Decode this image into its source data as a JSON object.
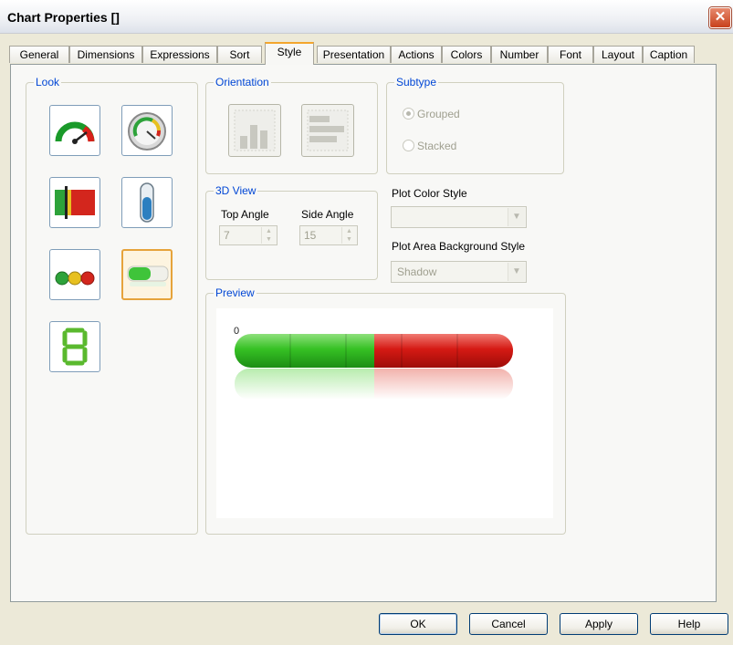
{
  "window": {
    "title": "Chart Properties []",
    "close_icon": "close-icon"
  },
  "tabs": [
    {
      "label": "General"
    },
    {
      "label": "Dimensions"
    },
    {
      "label": "Expressions"
    },
    {
      "label": "Sort"
    },
    {
      "label": "Style",
      "active": true
    },
    {
      "label": "Presentation"
    },
    {
      "label": "Actions"
    },
    {
      "label": "Colors"
    },
    {
      "label": "Number"
    },
    {
      "label": "Font"
    },
    {
      "label": "Layout"
    },
    {
      "label": "Caption"
    }
  ],
  "look": {
    "label": "Look",
    "options": [
      {
        "icon": "speedometer-gauge-icon"
      },
      {
        "icon": "circular-gauge-icon"
      },
      {
        "icon": "linear-gauge-icon"
      },
      {
        "icon": "thermometer-gauge-icon"
      },
      {
        "icon": "traffic-light-gauge-icon"
      },
      {
        "icon": "led-bar-gauge-icon",
        "selected": true
      },
      {
        "icon": "digital-display-icon"
      }
    ]
  },
  "orientation": {
    "label": "Orientation",
    "options": [
      {
        "icon": "vertical-bars-icon"
      },
      {
        "icon": "horizontal-bars-icon"
      }
    ]
  },
  "subtype": {
    "label": "Subtype",
    "options": [
      {
        "label": "Grouped",
        "checked": true
      },
      {
        "label": "Stacked",
        "checked": false
      }
    ]
  },
  "view3d": {
    "label": "3D View",
    "top_angle_label": "Top Angle",
    "top_angle_value": "7",
    "side_angle_label": "Side Angle",
    "side_angle_value": "15"
  },
  "plot_color_style": {
    "label": "Plot Color Style",
    "value": ""
  },
  "plot_area_bg": {
    "label": "Plot Area Background Style",
    "value": "Shadow"
  },
  "preview": {
    "label": "Preview",
    "min_label": "0",
    "green_fraction": 0.5,
    "green": "#2ec21f",
    "red": "#d31414"
  },
  "buttons": {
    "ok": "OK",
    "cancel": "Cancel",
    "apply": "Apply",
    "help": "Help"
  }
}
